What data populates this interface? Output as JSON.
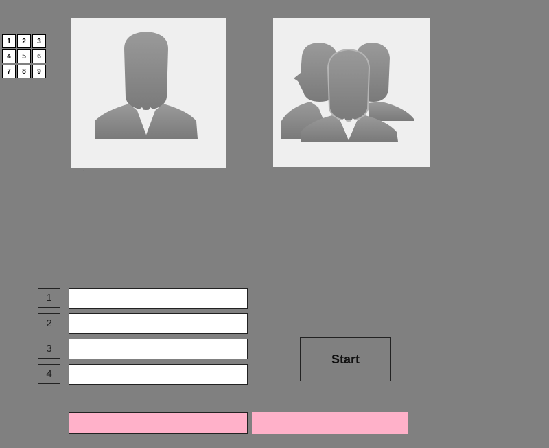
{
  "grid": {
    "cells": [
      "1",
      "2",
      "3",
      "4",
      "5",
      "6",
      "7",
      "8",
      "9"
    ]
  },
  "tiles": {
    "single_icon": "single-person-icon",
    "group_icon": "group-of-people-icon",
    "tile_background": "#efefef",
    "silhouette_color": "#8a8a8a"
  },
  "tiny_mark": "¨",
  "players": {
    "numbers": [
      "1",
      "2",
      "3",
      "4"
    ],
    "names": [
      "",
      "",
      "",
      ""
    ]
  },
  "start_button": {
    "label": "Start"
  },
  "status": {
    "left": "",
    "right": "",
    "color": "#ffb1c9"
  },
  "colors": {
    "background": "#808080"
  }
}
